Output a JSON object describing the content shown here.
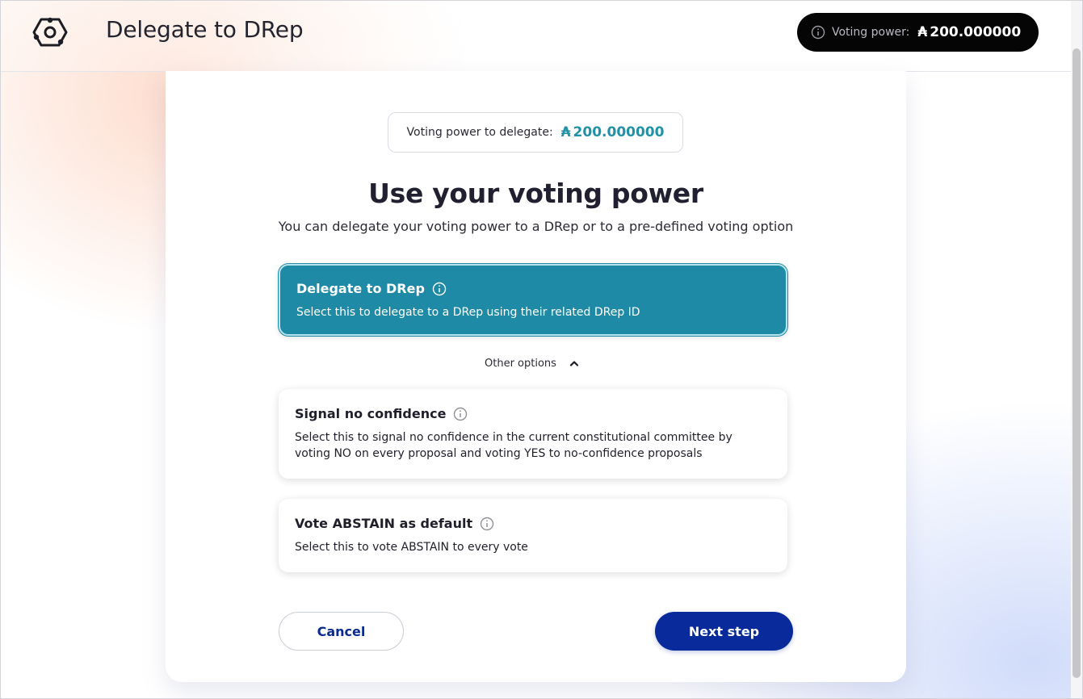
{
  "header": {
    "title": "Delegate to DRep",
    "logo_icon": "govtool-logo-icon",
    "voting_power_label": "Voting power:",
    "voting_power_symbol": "₳",
    "voting_power_value": "200.000000"
  },
  "main": {
    "delegate_label": "Voting power to delegate:",
    "delegate_symbol": "₳",
    "delegate_value": "200.000000",
    "heading": "Use your voting power",
    "subheading": "You can delegate your voting power to a DRep or to a pre-defined voting option",
    "options": [
      {
        "title": "Delegate to DRep",
        "description": "Select this to delegate to a DRep using their related DRep ID",
        "selected": true
      },
      {
        "title": "Signal no confidence",
        "description": "Select this to signal no confidence in the current constitutional committee by voting NO on every proposal and voting YES to no-confidence proposals",
        "selected": false
      },
      {
        "title": "Vote ABSTAIN as default",
        "description": "Select this to vote ABSTAIN to every vote",
        "selected": false
      }
    ],
    "other_options_label": "Other options",
    "cancel_label": "Cancel",
    "next_label": "Next step"
  },
  "colors": {
    "accent": "#1f8aa6",
    "primary_button": "#082a9b",
    "pill_background": "#050505",
    "ada_value": "#2191a8"
  }
}
